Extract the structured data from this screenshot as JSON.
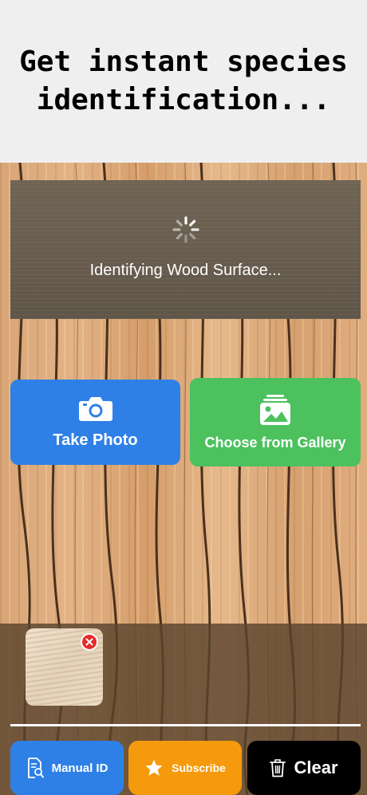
{
  "header": {
    "title": "Get instant species identification..."
  },
  "scanner": {
    "status_text": "Identifying Wood Surface..."
  },
  "capture": {
    "take_photo_label": "Take Photo",
    "gallery_label": "Choose from Gallery"
  },
  "actions": {
    "manual_id_label": "Manual ID",
    "subscribe_label": "Subscribe",
    "clear_label": "Clear"
  },
  "colors": {
    "photo_button": "#2f80e6",
    "gallery_button": "#4cc15e",
    "subscribe_button": "#f59a0c",
    "clear_button": "#000000",
    "remove_badge": "#e52b2b"
  },
  "icons": {
    "spinner": "loading-spinner-icon",
    "camera": "camera-icon",
    "gallery": "photo-gallery-icon",
    "remove": "close-icon",
    "manual": "document-search-icon",
    "subscribe": "star-icon",
    "clear": "trash-icon"
  }
}
